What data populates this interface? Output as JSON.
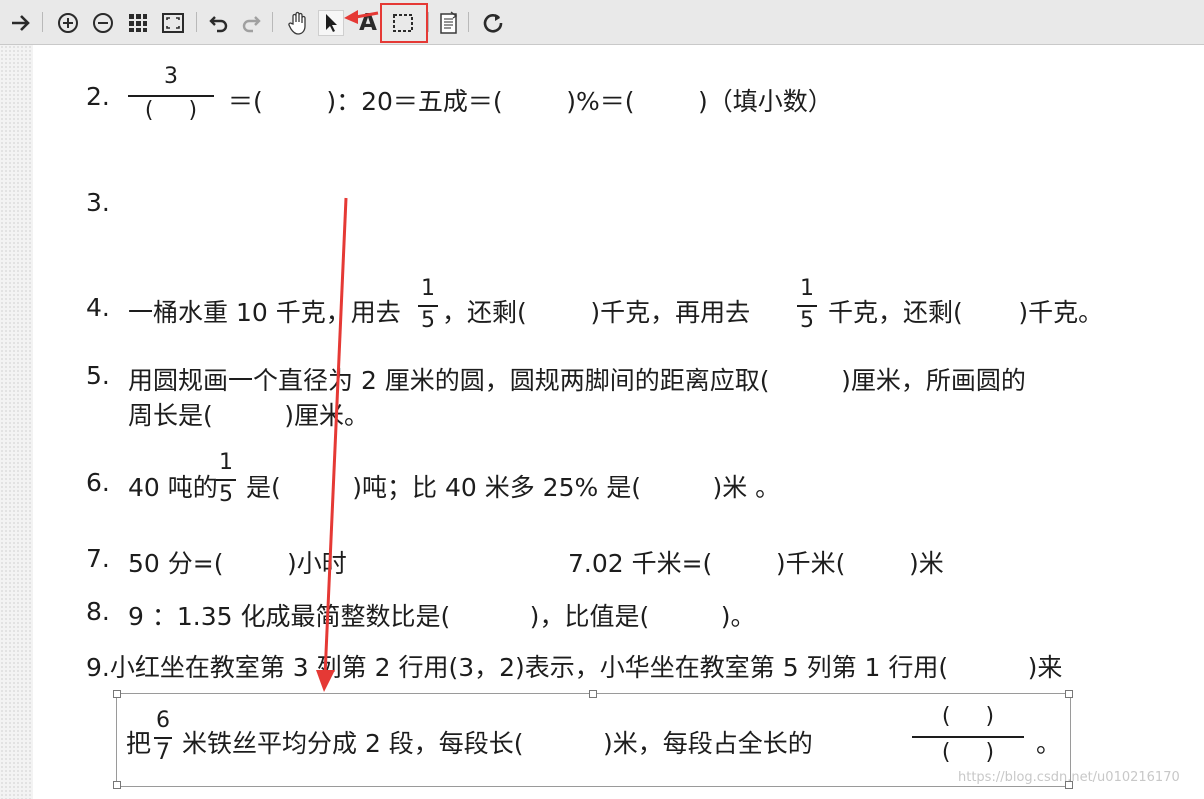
{
  "toolbar": {
    "icons": [
      "arrow-right-icon",
      "zoom-in-icon",
      "zoom-out-icon",
      "thumbnails-icon",
      "fit-screen-icon",
      "undo-icon",
      "redo-icon",
      "hand-icon",
      "pointer-icon",
      "text-icon",
      "marquee-select-icon",
      "notes-icon",
      "refresh-icon"
    ],
    "text_tool_label": "A"
  },
  "doc": {
    "q2": {
      "num": "2.",
      "frac_num": "3",
      "frac_den": "(     )",
      "rest": "＝(        )：20＝五成＝(        )%＝(        )（填小数）"
    },
    "q3": {
      "num": "3."
    },
    "q4": {
      "num": "4.",
      "a": "一桶水重 10 千克，用去",
      "b": "，还剩(        )千克，再用去",
      "c": "千克，还剩(       )千克。",
      "f1_num": "1",
      "f1_den": "5",
      "f2_num": "1",
      "f2_den": "5"
    },
    "q5": {
      "num": "5.",
      "line1": "用圆规画一个直径为 2 厘米的圆，圆规两脚间的距离应取(         )厘米，所画圆的",
      "line2": "周长是(         )厘米。"
    },
    "q6": {
      "num": "6.",
      "a": "40 吨的",
      "b": "是(         )吨；比 40 米多 25% 是(         )米 。",
      "f_num": "1",
      "f_den": "5"
    },
    "q7": {
      "num": "7.",
      "a": "50 分=(        )小时",
      "b": "7.02 千米=(        )千米(        )米"
    },
    "q8": {
      "num": "8.",
      "text": "9 ：1.35 化成最简整数比是(          )，比值是(         )。"
    },
    "q9": {
      "text": "9.小红坐在教室第 3 列第 2 行用(3，2)表示，小华坐在教室第 5 列第 1 行用(          )来"
    },
    "q10": {
      "a": "把",
      "f_num": "6",
      "f_den": "7",
      "b": "米铁丝平均分成 2 段，每段长(          )米，每段占全长的",
      "blank_num": "(     )",
      "blank_den": "(     )",
      "end": "。"
    }
  },
  "watermark": "https://blog.csdn.net/u010216170",
  "colors": {
    "annotation_red": "#e53935",
    "toolbar_bg": "#e9e9e9"
  }
}
